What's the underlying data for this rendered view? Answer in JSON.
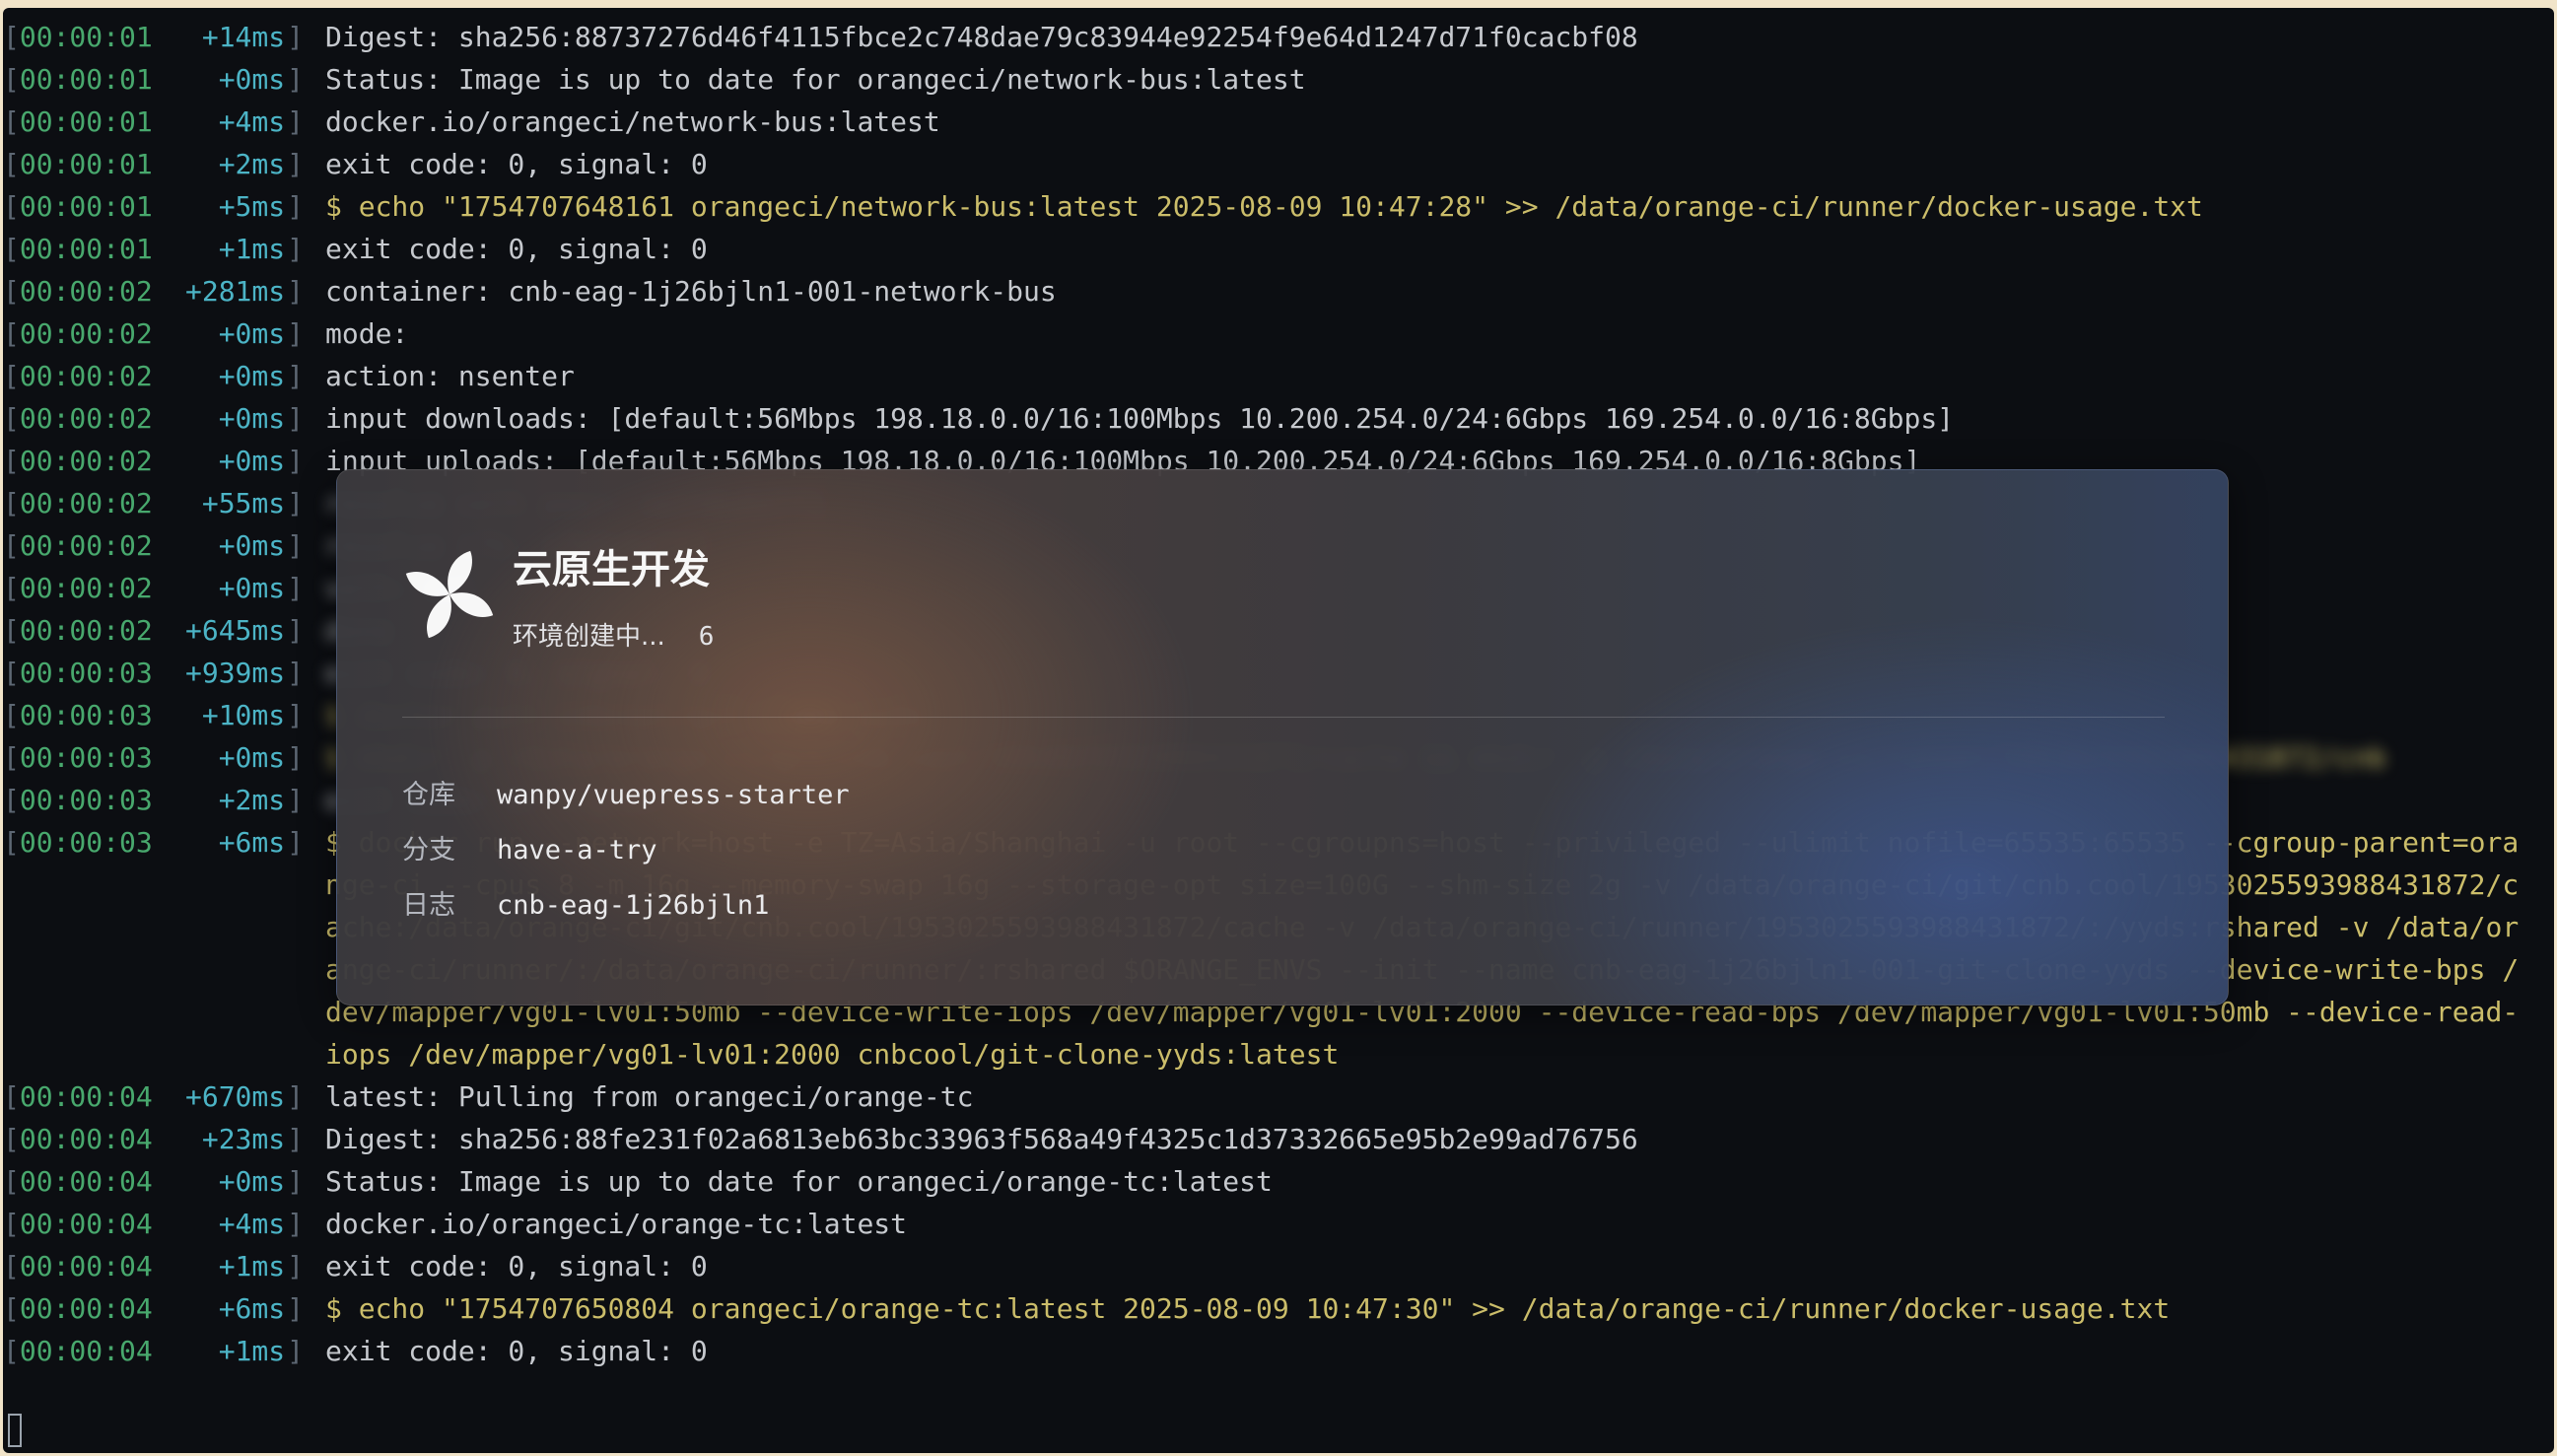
{
  "log": [
    {
      "ts": "00:00:01",
      "delta": "+14ms",
      "msg": "Digest: sha256:88737276d46f4115fbce2c748dae79c83944e92254f9e64d1247d71f0cacbf08"
    },
    {
      "ts": "00:00:01",
      "delta": "+0ms",
      "msg": "Status: Image is up to date for orangeci/network-bus:latest"
    },
    {
      "ts": "00:00:01",
      "delta": "+4ms",
      "msg": "docker.io/orangeci/network-bus:latest"
    },
    {
      "ts": "00:00:01",
      "delta": "+2ms",
      "msg": "exit code: 0, signal: 0"
    },
    {
      "ts": "00:00:01",
      "delta": "+5ms",
      "msg": "$ echo \"1754707648161 orangeci/network-bus:latest 2025-08-09 10:47:28\" >> /data/orange-ci/runner/docker-usage.txt",
      "cmd": true
    },
    {
      "ts": "00:00:01",
      "delta": "+1ms",
      "msg": "exit code: 0, signal: 0"
    },
    {
      "ts": "00:00:02",
      "delta": "+281ms",
      "msg": "container: cnb-eag-1j26bjln1-001-network-bus"
    },
    {
      "ts": "00:00:02",
      "delta": "+0ms",
      "msg": "mode:"
    },
    {
      "ts": "00:00:02",
      "delta": "+0ms",
      "msg": "action: nsenter"
    },
    {
      "ts": "00:00:02",
      "delta": "+0ms",
      "msg": "input downloads: [default:56Mbps 198.18.0.0/16:100Mbps 10.200.254.0/24:6Gbps 169.254.0.0/16:8Gbps]"
    },
    {
      "ts": "00:00:02",
      "delta": "+0ms",
      "msg": "input uploads: [default:56Mbps 198.18.0.0/16:100Mbps 10.200.254.0/24:6Gbps 169.254.0.0/16:8Gbps]"
    },
    {
      "ts": "00:00:02",
      "delta": "+55ms",
      "msg": "resolve veth peer: veth0a8d7f1",
      "blur": true
    },
    {
      "ts": "00:00:02",
      "delta": "+0ms",
      "msg": "resolve ifb: ifb0a8d7f1",
      "blur": true
    },
    {
      "ts": "00:00:02",
      "delta": "+0ms",
      "msg": "veth: set",
      "blur": true
    },
    {
      "ts": "00:00:02",
      "delta": "+645ms",
      "msg": "done",
      "blur": true
    },
    {
      "ts": "00:00:03",
      "delta": "+939ms",
      "msg": "exit code: 0, signal: 0",
      "blur": true
    },
    {
      "ts": "00:00:03",
      "delta": "+10ms",
      "msg": "$ docker pull cnbcool/git-clone-yyds",
      "blur": true,
      "cmd": true
    },
    {
      "ts": "00:00:03",
      "delta": "+0ms",
      "msg": "$ mkdir -p /data/orange-ci/git/cnb.cool/1953025593988431872/cache && mkdir -p /data/orange-ci/runner/1953025593988431872/cnb",
      "blur": true,
      "cmd": true
    },
    {
      "ts": "00:00:03",
      "delta": "+2ms",
      "msg": "exit code: 0, signal: 0",
      "blur": true
    },
    {
      "ts": "00:00:03",
      "delta": "+6ms",
      "msg": "$ docker run --network=host -e TZ=Asia/Shanghai -u root --cgroupns=host --privileged --ulimit nofile=65535:65535 --cgroup-parent=orange-ci --cpus 8 -m 16g --memory-swap 16g --storage-opt size=100G --shm-size 2g -v /data/orange-ci/git/cnb.cool/1953025593988431872/cache:/data/orange-ci/git/cnb.cool/1953025593988431872/cache -v /data/orange-ci/runner/1953025593988431872/:/yyds:rshared -v /data/orange-ci/runner/:/data/orange-ci/runner/:rshared $ORANGE_ENVS --init --name cnb-eag-1j26bjln1-001-git-clone-yyds --device-write-bps /dev/mapper/vg01-lv01:50mb --device-write-iops /dev/mapper/vg01-lv01:2000 --device-read-bps /dev/mapper/vg01-lv01:50mb --device-read-iops /dev/mapper/vg01-lv01:2000 cnbcool/git-clone-yyds:latest",
      "cmd": true
    },
    {
      "ts": "00:00:04",
      "delta": "+670ms",
      "msg": "latest: Pulling from orangeci/orange-tc"
    },
    {
      "ts": "00:00:04",
      "delta": "+23ms",
      "msg": "Digest: sha256:88fe231f02a6813eb63bc33963f568a49f4325c1d37332665e95b2e99ad76756"
    },
    {
      "ts": "00:00:04",
      "delta": "+0ms",
      "msg": "Status: Image is up to date for orangeci/orange-tc:latest"
    },
    {
      "ts": "00:00:04",
      "delta": "+4ms",
      "msg": "docker.io/orangeci/orange-tc:latest"
    },
    {
      "ts": "00:00:04",
      "delta": "+1ms",
      "msg": "exit code: 0, signal: 0"
    },
    {
      "ts": "00:00:04",
      "delta": "+6ms",
      "msg": "$ echo \"1754707650804 orangeci/orange-tc:latest 2025-08-09 10:47:30\" >> /data/orange-ci/runner/docker-usage.txt",
      "cmd": true
    },
    {
      "ts": "00:00:04",
      "delta": "+1ms",
      "msg": "exit code: 0, signal: 0"
    }
  ],
  "overlay": {
    "logo_icon": "pinwheel-logo-icon",
    "title": "云原生开发",
    "status_text": "环境创建中...",
    "status_count": "6",
    "info": [
      {
        "key": "仓库",
        "value": "wanpy/vuepress-starter"
      },
      {
        "key": "分支",
        "value": "have-a-try"
      },
      {
        "key": "日志",
        "value": "cnb-eag-1j26bjln1"
      }
    ]
  }
}
